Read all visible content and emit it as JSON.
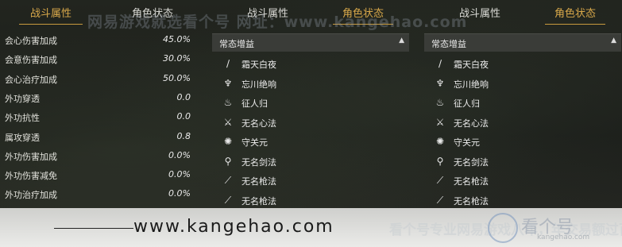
{
  "stats_panel": {
    "tabs": [
      "战斗属性",
      "角色状态"
    ],
    "rows": [
      {
        "label": "会心伤害加成",
        "value": "45.0%"
      },
      {
        "label": "会意伤害加成",
        "value": "30.0%"
      },
      {
        "label": "会心治疗加成",
        "value": "50.0%"
      },
      {
        "label": "外功穿透",
        "value": "0.0"
      },
      {
        "label": "外功抗性",
        "value": "0.0"
      },
      {
        "label": "属攻穿透",
        "value": "0.8"
      },
      {
        "label": "外功伤害加成",
        "value": "0.0%"
      },
      {
        "label": "外功伤害减免",
        "value": "0.0%"
      },
      {
        "label": "外功治疗加成",
        "value": "0.0%"
      }
    ]
  },
  "buff_panel_1": {
    "tabs": [
      "战斗属性",
      "角色状态"
    ],
    "header": "常态增益",
    "items": [
      {
        "icon": "spear-icon",
        "glyph": "∕",
        "name": "霜天白夜"
      },
      {
        "icon": "blade-icon",
        "glyph": "♆",
        "name": "忘川绝响"
      },
      {
        "icon": "flame-icon",
        "glyph": "♨",
        "name": "征人归"
      },
      {
        "icon": "sword-stance-icon",
        "glyph": "⚔",
        "name": "无名心法"
      },
      {
        "icon": "shield-icon",
        "glyph": "✺",
        "name": "守关元"
      },
      {
        "icon": "sword-icon",
        "glyph": "⚲",
        "name": "无名剑法"
      },
      {
        "icon": "spear-icon",
        "glyph": "⟋",
        "name": "无名枪法"
      },
      {
        "icon": "spear-icon",
        "glyph": "⟋",
        "name": "无名枪法"
      }
    ]
  },
  "buff_panel_2": {
    "tabs": [
      "战斗属性",
      "角色状态"
    ],
    "header": "常态增益",
    "items": [
      {
        "icon": "spear-icon",
        "glyph": "∕",
        "name": "霜天白夜"
      },
      {
        "icon": "blade-icon",
        "glyph": "♆",
        "name": "忘川绝响"
      },
      {
        "icon": "flame-icon",
        "glyph": "♨",
        "name": "征人归"
      },
      {
        "icon": "sword-stance-icon",
        "glyph": "⚔",
        "name": "无名心法"
      },
      {
        "icon": "shield-icon",
        "glyph": "✺",
        "name": "守关元"
      },
      {
        "icon": "sword-icon",
        "glyph": "⚲",
        "name": "无名剑法"
      },
      {
        "icon": "spear-icon",
        "glyph": "⟋",
        "name": "无名枪法"
      },
      {
        "icon": "spear-icon",
        "glyph": "⟋",
        "name": "无名枪法"
      }
    ]
  },
  "watermark": {
    "top_text": "网易游戏就选看个号 网址：www.kangehao.com",
    "url": "www.kangehao.com",
    "slogan": "看个号专业网易游戏八年，年交易额过百亿",
    "logo_text": "看个号",
    "logo_sub": "kangehao.com"
  },
  "colors": {
    "active_tab": "#d8a84a",
    "header_bg": "#3a3c38"
  }
}
